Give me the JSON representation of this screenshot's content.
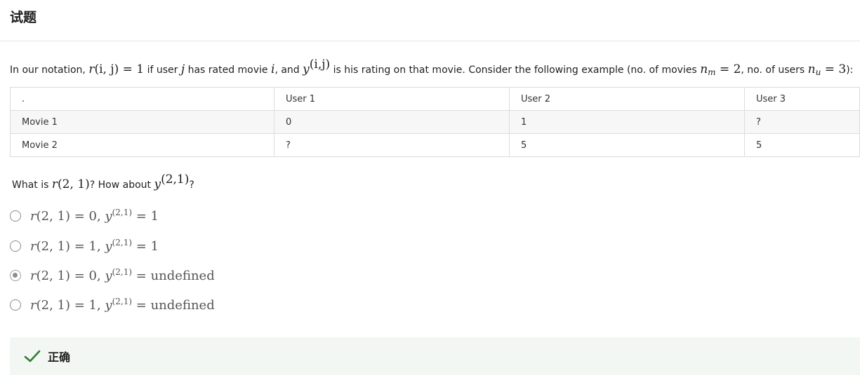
{
  "page": {
    "title": "试题"
  },
  "prompt": {
    "p1": "In our notation, ",
    "m_r": "r",
    "m_args": "(i, j) = 1",
    "p2": " if user ",
    "m_j": "j",
    "p3": " has rated movie ",
    "m_i": "i",
    "p4": ", and ",
    "m_y": "y",
    "m_ysup": "(i,j)",
    "p5": " is his rating on that movie. Consider the following example (no. of movies ",
    "m_nm": "n",
    "m_nm_sub": "m",
    "m_nm_val": " = 2",
    "p6": ", no. of users ",
    "m_nu": "n",
    "m_nu_sub": "u",
    "m_nu_val": " = 3",
    "p7": "):"
  },
  "table": {
    "headers": [
      ".",
      "User 1",
      "User 2",
      "User 3"
    ],
    "rows": [
      [
        "Movie 1",
        "0",
        "1",
        "?"
      ],
      [
        "Movie 2",
        "?",
        "5",
        "5"
      ]
    ]
  },
  "question": {
    "q1": "What is ",
    "m_r": "r",
    "m_rargs": "(2, 1)",
    "q2": "? How about ",
    "m_y": "y",
    "m_ysup": "(2,1)",
    "q3": "?"
  },
  "options": [
    {
      "r_part": "(2, 1) = 0,  ",
      "sup": "(2,1)",
      "rhs": " = 1",
      "selected": false
    },
    {
      "r_part": "(2, 1) = 1,  ",
      "sup": "(2,1)",
      "rhs": " = 1",
      "selected": false
    },
    {
      "r_part": "(2, 1) = 0,  ",
      "sup": "(2,1)",
      "rhs": " = undefined",
      "selected": true
    },
    {
      "r_part": "(2, 1) = 1,  ",
      "sup": "(2,1)",
      "rhs": " = undefined",
      "selected": false
    }
  ],
  "option_symbols": {
    "r": "r",
    "y": "y"
  },
  "feedback": {
    "status": "正确",
    "icon": "check-icon",
    "color": "#2e7d32"
  }
}
